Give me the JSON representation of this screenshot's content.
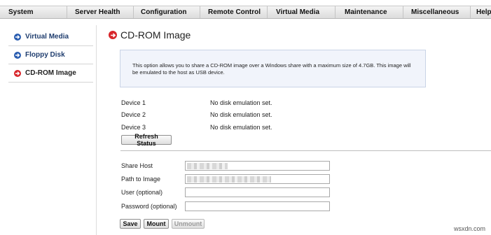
{
  "topnav": [
    {
      "label": "System"
    },
    {
      "label": "Server Health"
    },
    {
      "label": "Configuration"
    },
    {
      "label": "Remote Control"
    },
    {
      "label": "Virtual Media"
    },
    {
      "label": "Maintenance"
    },
    {
      "label": "Miscellaneous"
    },
    {
      "label": "Help"
    }
  ],
  "sidebar": {
    "items": [
      {
        "label": "Virtual Media",
        "icon": "arrow-circle-icon",
        "color": "#2a5db0"
      },
      {
        "label": "Floppy Disk",
        "icon": "arrow-circle-icon",
        "color": "#2a5db0"
      },
      {
        "label": "CD-ROM Image",
        "icon": "arrow-circle-icon",
        "color": "#d8262b",
        "active": true
      }
    ]
  },
  "page": {
    "title": "CD-ROM Image",
    "info": "This option allows you to share a CD-ROM image over a Windows share with a maximum size of 4.7GB. This image will be emulated to the host as USB device."
  },
  "devices": [
    {
      "label": "Device 1",
      "status": "No disk emulation set."
    },
    {
      "label": "Device 2",
      "status": "No disk emulation set."
    },
    {
      "label": "Device 3",
      "status": "No disk emulation set."
    }
  ],
  "refresh_label": "Refresh Status",
  "form": {
    "share_host_label": "Share Host",
    "path_label": "Path to Image",
    "user_label": "User (optional)",
    "password_label": "Password (optional)"
  },
  "buttons": {
    "save": "Save",
    "mount": "Mount",
    "unmount": "Unmount",
    "unmount_disabled": true
  },
  "watermark": "wsxdn.com"
}
